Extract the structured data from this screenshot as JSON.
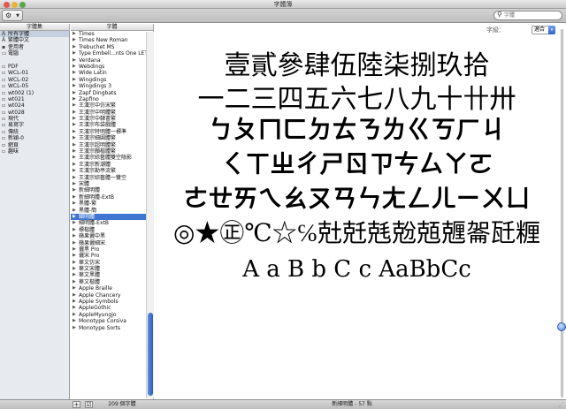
{
  "window": {
    "title": "字體簿"
  },
  "toolbar": {
    "action_label": "⚙",
    "search_placeholder": "字體"
  },
  "columns": {
    "collection": "字體集",
    "font": "字體"
  },
  "collections": [
    {
      "label": "所有字體",
      "icon": "library-icon",
      "selected": true
    },
    {
      "label": "繁體中文",
      "icon": "library-icon"
    },
    {
      "label": "使用者",
      "icon": "user-icon"
    },
    {
      "label": "電腦",
      "icon": "computer-icon"
    },
    {
      "label": ""
    },
    {
      "label": "PDF",
      "icon": "collection-icon"
    },
    {
      "label": "WCL-01",
      "icon": "collection-icon"
    },
    {
      "label": "WCL-02",
      "icon": "collection-icon"
    },
    {
      "label": "WCL-05",
      "icon": "collection-icon"
    },
    {
      "label": "wt002 (1)",
      "icon": "collection-icon"
    },
    {
      "label": "wt021",
      "icon": "collection-icon"
    },
    {
      "label": "wt024",
      "icon": "collection-icon"
    },
    {
      "label": "wt028",
      "icon": "collection-icon"
    },
    {
      "label": "現代",
      "icon": "collection-icon"
    },
    {
      "label": "易寫字",
      "icon": "collection-icon"
    },
    {
      "label": "傳統",
      "icon": "collection-icon"
    },
    {
      "label": "新穎-0",
      "icon": "collection-icon"
    },
    {
      "label": "網頁",
      "icon": "collection-icon"
    },
    {
      "label": "趣味",
      "icon": "collection-icon"
    }
  ],
  "fonts": [
    {
      "label": "Times"
    },
    {
      "label": "Times New Roman"
    },
    {
      "label": "Trebuchet MS"
    },
    {
      "label": "Type Embell...nts One LET"
    },
    {
      "label": "Verdana"
    },
    {
      "label": "Webdings"
    },
    {
      "label": "Wide Latin"
    },
    {
      "label": "Wingdings"
    },
    {
      "label": "Wingdings 3"
    },
    {
      "label": "Zapf Dingbats"
    },
    {
      "label": "Zapfino"
    },
    {
      "label": "王漢宗中仿宋繁"
    },
    {
      "label": "王漢宗中明體繁"
    },
    {
      "label": "王漢宗中隸書繁"
    },
    {
      "label": "王漢宗布袋戲體"
    },
    {
      "label": "王漢宗特明體一標準"
    },
    {
      "label": "王漢宗細圓體繁"
    },
    {
      "label": "王漢宗超明體繁"
    },
    {
      "label": "王漢宗顏楷體繁"
    },
    {
      "label": "王漢宗綜藝體雙空陰影"
    },
    {
      "label": "王漢宗新潮體"
    },
    {
      "label": "王漢宗勘亭流繁"
    },
    {
      "label": "王漢宗綜藝體一雙空"
    },
    {
      "label": "宋體"
    },
    {
      "label": "新細明體"
    },
    {
      "label": "新細明體-ExtB"
    },
    {
      "label": "黑體-繁"
    },
    {
      "label": "黑體-簡"
    },
    {
      "label": "細明體",
      "selected": true
    },
    {
      "label": "細明體-ExtB"
    },
    {
      "label": "標楷體"
    },
    {
      "label": "蘋果儷中黑"
    },
    {
      "label": "蘋果儷細宋"
    },
    {
      "label": "儷黑 Pro"
    },
    {
      "label": "儷宋 Pro"
    },
    {
      "label": "華文仿宋"
    },
    {
      "label": "華文宋體"
    },
    {
      "label": "華文黑體"
    },
    {
      "label": "華文楷體"
    },
    {
      "label": "Apple Braille"
    },
    {
      "label": "Apple Chancery"
    },
    {
      "label": "Apple Symbols"
    },
    {
      "label": "AppleGothic"
    },
    {
      "label": "AppleMyungjo"
    },
    {
      "label": "Monotype Corsiva"
    },
    {
      "label": "Monotype Sorts"
    }
  ],
  "preview": {
    "size_label": "字級：",
    "size_value": "適合",
    "lines": [
      "壹貳參肆伍陸柒捌玖拾",
      "一二三四五六七八九十卄卅",
      "ㄅㄆㄇㄈㄉㄊㄋㄌㄍㄎㄏㄐ",
      "ㄑㄒㄓㄔㄕㄖㄗㄘㄙㄚㄛ",
      "ㄜㄝㄞㄟㄠㄡㄢㄣㄤㄥㄦㄧㄨㄩ",
      "◎★㊣℃☆℅兙兛兞兝兡兣嗧瓩糎",
      "A a B b C c AaBbCc"
    ]
  },
  "status": {
    "font_count": "209 個字體",
    "selected_font_info": "新細明體 - 57 點"
  }
}
